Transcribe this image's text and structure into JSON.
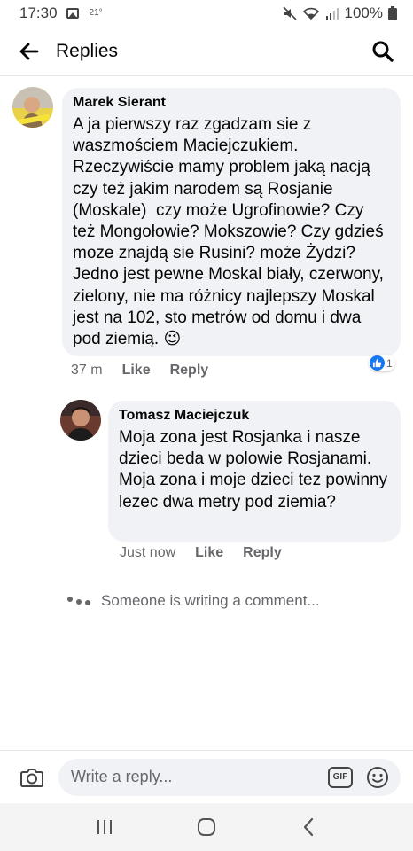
{
  "status_bar": {
    "time": "17:30",
    "temp": "21°",
    "battery": "100%"
  },
  "header": {
    "title": "Replies"
  },
  "comments": [
    {
      "author": "Marek Sierant",
      "text": "A ja pierwszy raz zgadzam sie z waszmościem Maciejczukiem. Rzeczywiście mamy problem jaką nacją czy też jakim narodem są Rosjanie (Moskale)  czy może Ugrofinowie? Czy też Mongołowie? Mokszowie? Czy gdzieś moze znajdą sie Rusini? może Żydzi? Jedno jest pewne Moskal biały, czerwony, zielony, nie ma różnicy najlepszy Moskal jest na 102, sto metrów od domu i dwa pod ziemią. 😉",
      "time": "37 m",
      "like_label": "Like",
      "reply_label": "Reply",
      "reaction_count": "1"
    },
    {
      "author": "Tomasz Maciejczuk",
      "text": "Moja zona jest Rosjanka i nasze dzieci beda w polowie Rosjanami. Moja zona i moje dzieci tez powinny lezec dwa metry pod ziemia?",
      "time": "Just now",
      "like_label": "Like",
      "reply_label": "Reply"
    }
  ],
  "typing_indicator": "Someone is writing a comment...",
  "composer": {
    "placeholder": "Write a reply...",
    "gif_label": "GIF"
  },
  "colors": {
    "bubble_bg": "#f0f2f5",
    "meta_text": "#65676b",
    "like_blue": "#1877f2"
  },
  "icons": [
    "back-arrow-icon",
    "search-icon",
    "camera-icon",
    "gif-icon",
    "emoji-icon",
    "recent-apps-icon",
    "home-icon",
    "back-nav-icon",
    "like-icon"
  ]
}
